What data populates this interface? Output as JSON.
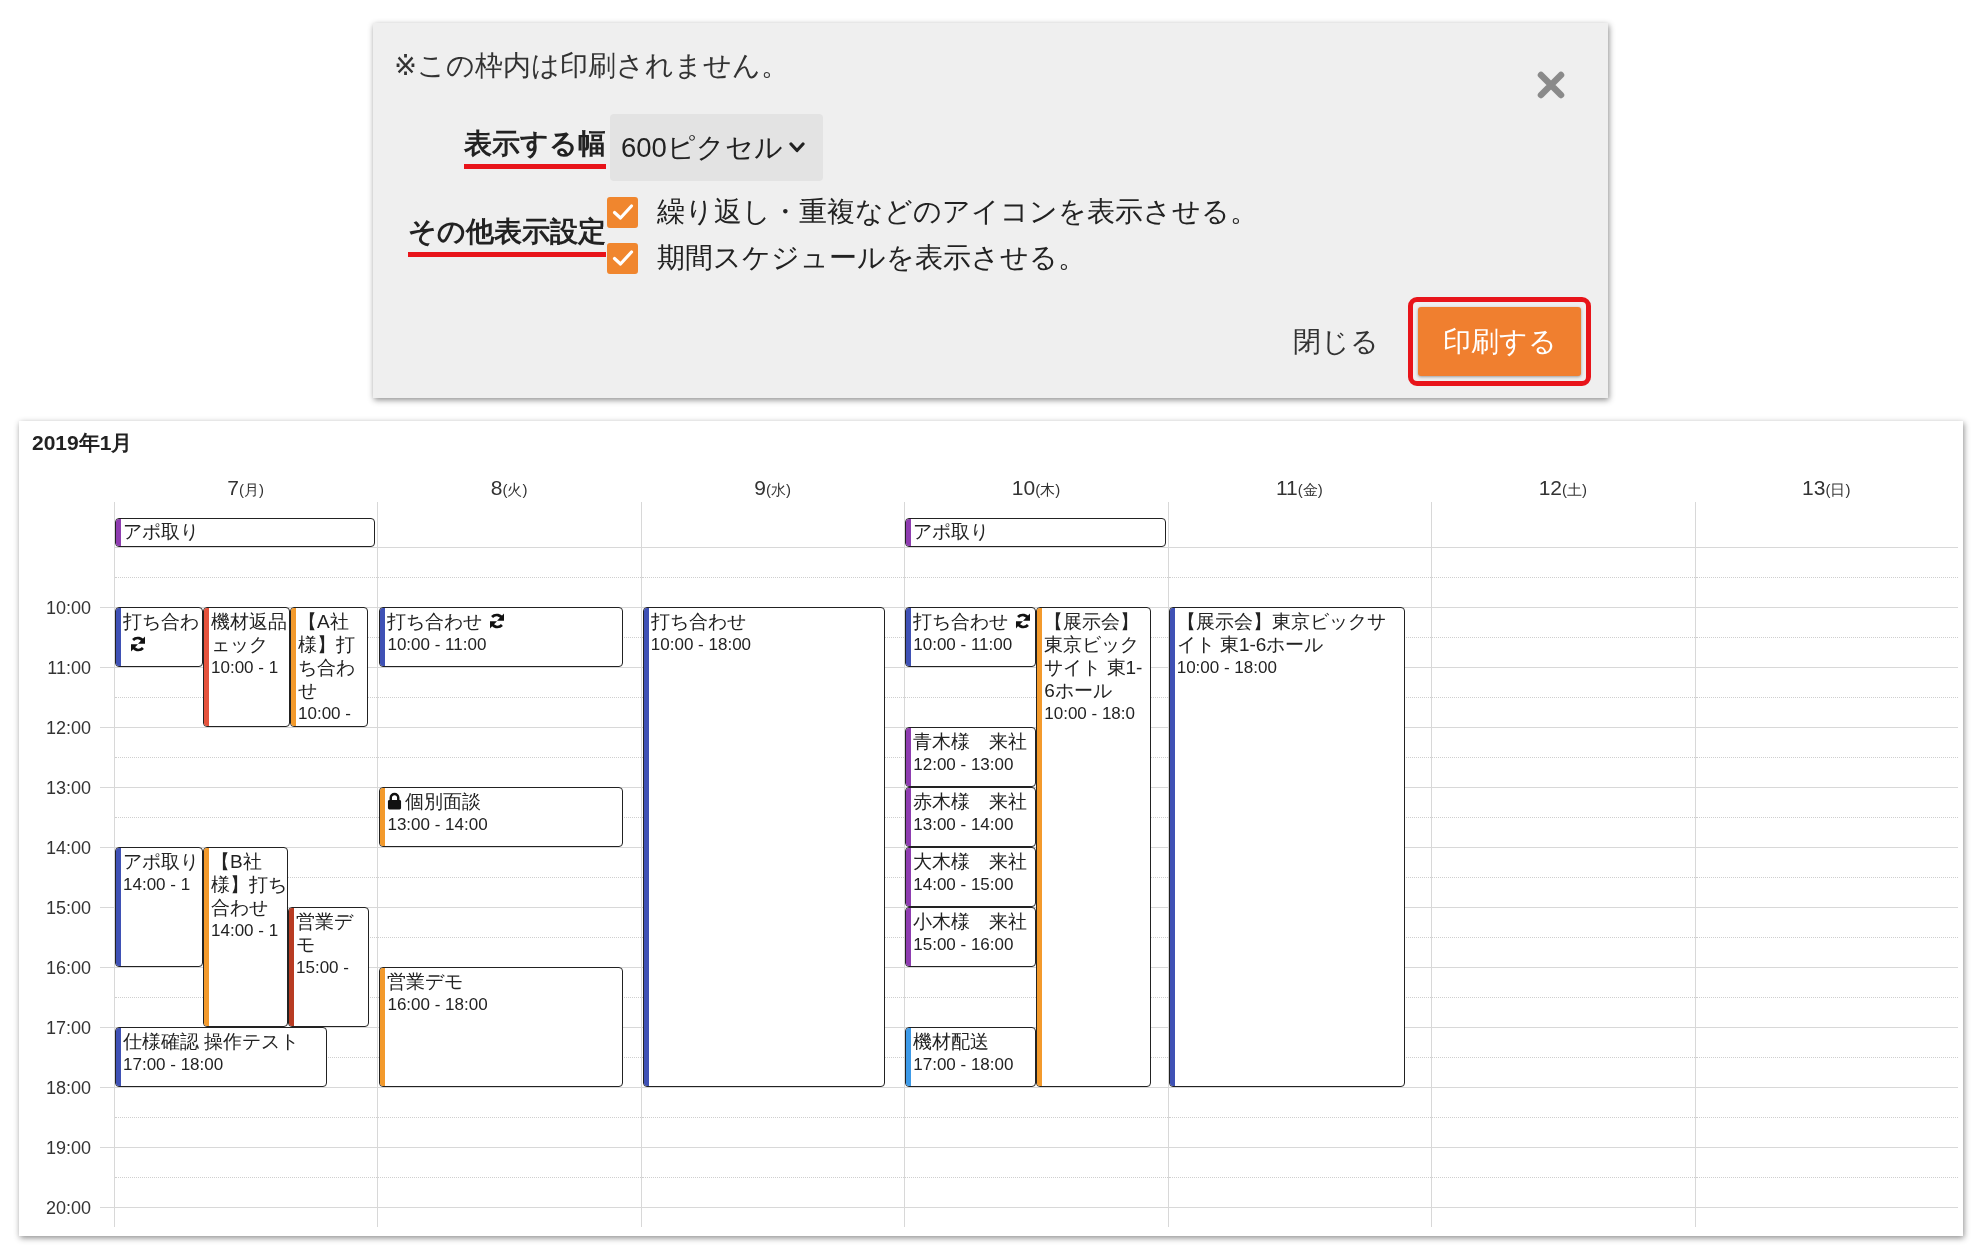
{
  "print_dialog": {
    "notice": "※この枠内は印刷されません。",
    "width_setting": {
      "label": "表示する幅",
      "highlighted": true,
      "value": "600ピクセル"
    },
    "display_settings": {
      "label": "その他表示設定",
      "highlighted": true,
      "options": [
        {
          "label": "繰り返し・重複などのアイコンを表示させる。",
          "checked": true
        },
        {
          "label": "期間スケジュールを表示させる。",
          "checked": true
        }
      ]
    },
    "buttons": [
      {
        "label": "閉じる",
        "kind": "link",
        "highlighted": false
      },
      {
        "label": "印刷する",
        "kind": "primary",
        "highlighted": true
      }
    ]
  },
  "calendar": {
    "month": "2019年1月",
    "days": [
      {
        "day": "7",
        "weekday": "(月)",
        "all_day": [
          {
            "title": "アポ取り",
            "color": "#8e3cb0"
          }
        ],
        "events": [
          {
            "title": "打ち合わ",
            "recurring": true,
            "locked": false,
            "color": "#3f51b5"
          },
          {
            "title": "機材返品ェック",
            "time": "10:00 - 1",
            "recurring": false,
            "locked": false,
            "color": "#e5533d"
          },
          {
            "title": "【A社様】打ち合わせ",
            "time": "10:00 -",
            "recurring": false,
            "locked": false,
            "color": "#f39a2c"
          },
          {
            "title": "アポ取り",
            "time": "14:00 - 1",
            "recurring": false,
            "locked": false,
            "color": "#3f51b5"
          },
          {
            "title": "【B社様】打ち合わせ",
            "time": "14:00 - 1",
            "recurring": false,
            "locked": false,
            "color": "#f39a2c"
          },
          {
            "title": "営業デモ",
            "time": "15:00 -",
            "recurring": false,
            "locked": false,
            "color": "#b83b22"
          },
          {
            "title": "仕様確認 操作テスト",
            "time": "17:00 - 18:00",
            "recurring": false,
            "locked": false,
            "color": "#3f51b5"
          }
        ]
      },
      {
        "day": "8",
        "weekday": "(火)",
        "events": [
          {
            "title": "打ち合わせ",
            "time": "10:00 - 11:00",
            "recurring": true,
            "locked": false,
            "color": "#3f51b5"
          },
          {
            "title": "個別面談",
            "time": "13:00 - 14:00",
            "recurring": false,
            "locked": true,
            "color": "#f39a2c"
          },
          {
            "title": "営業デモ",
            "time": "16:00 - 18:00",
            "recurring": false,
            "locked": false,
            "color": "#f39a2c"
          }
        ]
      },
      {
        "day": "9",
        "weekday": "(水)",
        "events": [
          {
            "title": "打ち合わせ",
            "time": "10:00 - 18:00",
            "recurring": false,
            "locked": false,
            "color": "#3f51b5"
          }
        ]
      },
      {
        "day": "10",
        "weekday": "(木)",
        "all_day": [
          {
            "title": "アポ取り",
            "color": "#8e3cb0"
          }
        ],
        "events": [
          {
            "title": "打ち合わせ",
            "time": "10:00 - 11:00",
            "recurring": true,
            "locked": false,
            "color": "#3f51b5"
          },
          {
            "title": "【展示会】東京ビックサイト 東1-6ホール",
            "time": "10:00 - 18:0",
            "recurring": false,
            "locked": false,
            "color": "#f39a2c"
          },
          {
            "title": "青木様　来社",
            "time": "12:00 - 13:00",
            "recurring": false,
            "locked": false,
            "color": "#8e3cb0"
          },
          {
            "title": "赤木様　来社",
            "time": "13:00 - 14:00",
            "recurring": false,
            "locked": false,
            "color": "#8e3cb0"
          },
          {
            "title": "大木様　来社",
            "time": "14:00 - 15:00",
            "recurring": false,
            "locked": false,
            "color": "#8e3cb0"
          },
          {
            "title": "小木様　来社",
            "time": "15:00 - 16:00",
            "recurring": false,
            "locked": false,
            "color": "#8e3cb0"
          },
          {
            "title": "機材配送",
            "time": "17:00 - 18:00",
            "recurring": false,
            "locked": false,
            "color": "#3d9ae8"
          }
        ]
      },
      {
        "day": "11",
        "weekday": "(金)",
        "events": [
          {
            "title": "【展示会】東京ビックサイト 東1-6ホール",
            "time": "10:00 - 18:00",
            "recurring": false,
            "locked": false,
            "color": "#3f51b5"
          }
        ]
      },
      {
        "day": "12",
        "weekday": "(土)"
      },
      {
        "day": "13",
        "weekday": "(日)"
      }
    ],
    "times": [
      "10:00",
      "11:00",
      "12:00",
      "13:00",
      "14:00",
      "15:00",
      "16:00",
      "17:00",
      "18:00",
      "19:00",
      "20:00"
    ]
  }
}
